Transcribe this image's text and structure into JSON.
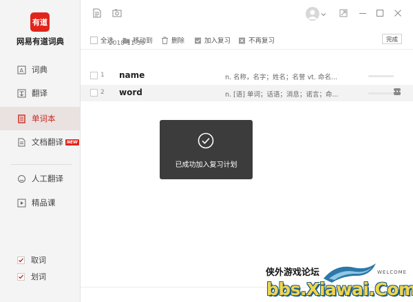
{
  "app": {
    "logo_text": "有道",
    "name": "网易有道词典"
  },
  "sidebar": {
    "items": [
      {
        "label": "词典"
      },
      {
        "label": "翻译"
      },
      {
        "label": "单词本"
      },
      {
        "label": "文档翻译",
        "badge": "NEW"
      },
      {
        "label": "人工翻译"
      },
      {
        "label": "精品课"
      }
    ],
    "active_index": 2,
    "checks": [
      {
        "label": "取词",
        "checked": true
      },
      {
        "label": "划词",
        "checked": true
      }
    ]
  },
  "toolbar": {
    "select_all": "全选",
    "move_to": "移动到",
    "delete": "删除",
    "add_review": "加入复习",
    "no_review": "不再复习",
    "done": "完成"
  },
  "wordlist": {
    "date": "2018-11-30",
    "rows": [
      {
        "num": "1",
        "word": "name",
        "def": "n. 名称，名字；姓名；名誉 vt. 命名..."
      },
      {
        "num": "2",
        "word": "word",
        "def": "n. [语] 单词；话语；消息；诺言；命..."
      }
    ]
  },
  "toast": {
    "message": "已成功加入复习计划"
  },
  "status": {
    "text": "...... ..."
  },
  "watermark": {
    "cn": "侠外游戏论坛",
    "welcome": "WELCOME",
    "url": "bbs.Xiawai.Com"
  },
  "colors": {
    "accent": "#e1251b",
    "toast_bg": "#323232"
  }
}
